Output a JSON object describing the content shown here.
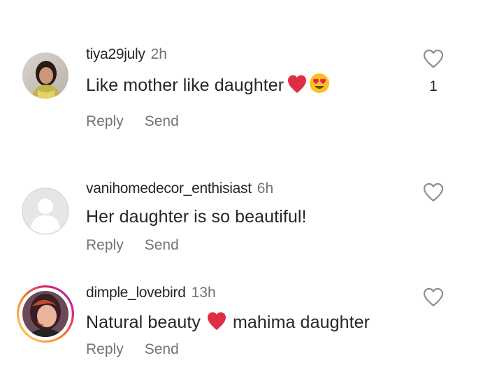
{
  "reply_label": "Reply",
  "send_label": "Send",
  "comments": [
    {
      "username": "tiya29july",
      "time": "2h",
      "text": "Like mother like daughter",
      "emojis": [
        "red-heart",
        "heart-eyes-face"
      ],
      "like_count": "1"
    },
    {
      "username": "vanihomedecor_enthisiast",
      "time": "6h",
      "text": "Her daughter is so beautiful!",
      "emojis": [],
      "like_count": ""
    },
    {
      "username": "dimple_lovebird",
      "time": "13h",
      "text_before": "Natural beauty",
      "text_after": "mahima daughter",
      "emojis": [
        "red-heart"
      ],
      "like_count": ""
    }
  ],
  "colors": {
    "primary_text": "#262626",
    "secondary_text": "#737373",
    "heart_outline": "#8e8e8e",
    "story_ring_start": "#feda75",
    "story_ring_end": "#d62976"
  }
}
